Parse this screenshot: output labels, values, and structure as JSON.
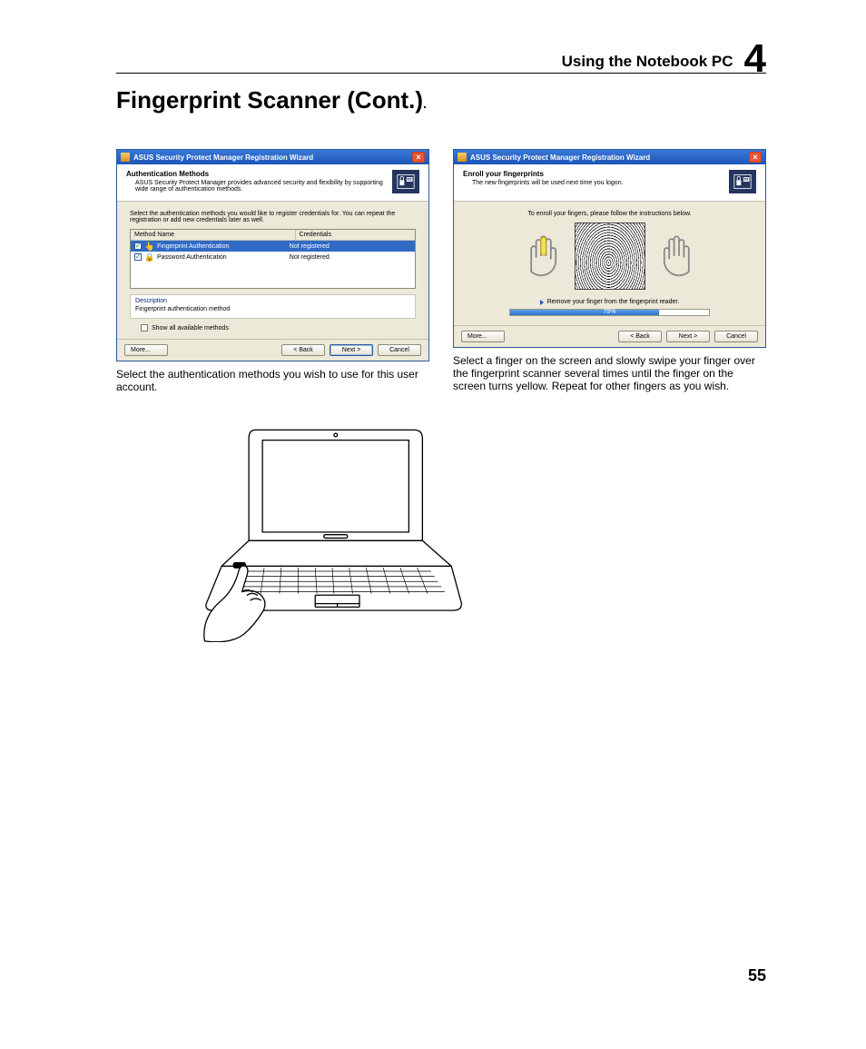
{
  "header": {
    "section": "Using the Notebook PC",
    "chapter": "4"
  },
  "title": "Fingerprint Scanner (Cont.)",
  "page_number": "55",
  "dialog_a": {
    "window_title": "ASUS Security Protect Manager Registration Wizard",
    "head_title": "Authentication Methods",
    "head_desc": "ASUS Security Protect Manager provides advanced security and flexibility by supporting wide range of authentication methods.",
    "intro": "Select the authentication methods you would like to register credentials for. You can repeat the registration or add new credentials later as well.",
    "columns": {
      "name": "Method Name",
      "cred": "Credentials"
    },
    "rows": [
      {
        "name": "Fingerprint Authentication",
        "cred": "Not registered",
        "checked": true,
        "selected": true,
        "icon": "finger"
      },
      {
        "name": "Password Authentication",
        "cred": "Not registered",
        "checked": true,
        "selected": false,
        "icon": "lock"
      }
    ],
    "desc_label": "Description",
    "desc_text": "Fingerprint authentication method",
    "show_all": "Show all available methods",
    "buttons": {
      "more": "More...",
      "back": "< Back",
      "next": "Next >",
      "cancel": "Cancel"
    }
  },
  "dialog_b": {
    "window_title": "ASUS Security Protect Manager Registration Wizard",
    "head_title": "Enroll your fingerprints",
    "head_desc": "The new fingerprints will be used next time you logon.",
    "instruction": "To enroll your fingers, please follow the instructions below.",
    "remove_msg": "Remove your finger from the fingerprint reader.",
    "progress_pct": "75%",
    "buttons": {
      "more": "More...",
      "back": "< Back",
      "next": "Next >",
      "cancel": "Cancel"
    }
  },
  "caption_a": "Select the authentication methods you wish to use for this user account.",
  "caption_b": "Select a finger on the screen and slowly swipe your finger over the fingerprint scanner several times until the finger on the screen turns yellow. Repeat for other fingers as you wish."
}
